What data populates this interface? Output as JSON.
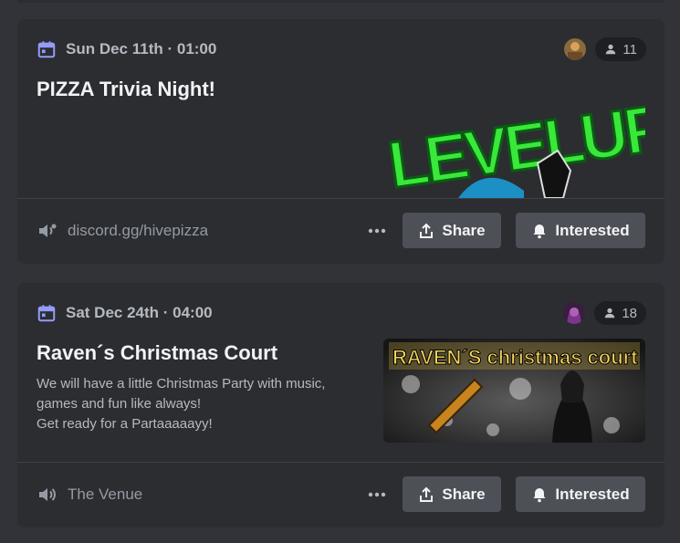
{
  "events": [
    {
      "date": "Sun Dec 11th · 01:00",
      "interested_count": "11",
      "title": "PIZZA Trivia Night!",
      "description": [],
      "location": "discord.gg/hivepizza",
      "banner_text": "LEVELUP",
      "share_label": "Share",
      "interested_label": "Interested"
    },
    {
      "date": "Sat Dec 24th · 04:00",
      "interested_count": "18",
      "title": "Raven´s Christmas Court",
      "description": [
        "We will have a little Christmas Party with music,",
        "games and fun like always!",
        "Get ready for a Partaaaaayy!"
      ],
      "location": "The Venue",
      "banner_text": "RAVEN´S christmas court",
      "share_label": "Share",
      "interested_label": "Interested"
    }
  ],
  "colors": {
    "background": "#313338",
    "card": "#2b2d31",
    "button": "#4e5058",
    "accent_calendar": "#949cf7",
    "banner_green": "#39e83a"
  }
}
